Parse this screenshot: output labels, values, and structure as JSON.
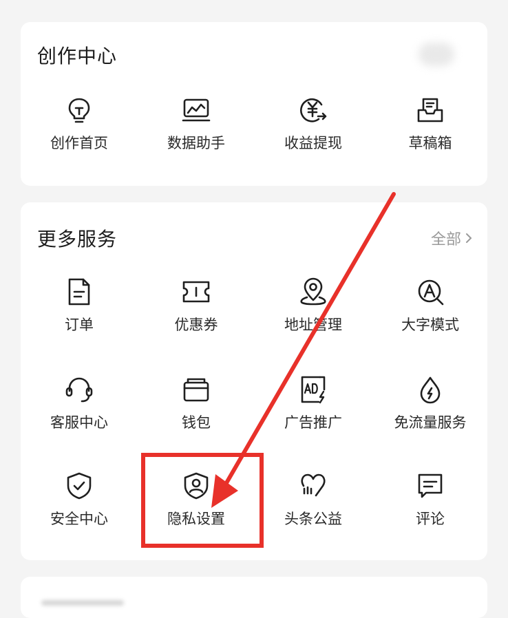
{
  "creation_center": {
    "title": "创作中心",
    "items": [
      {
        "label": "创作首页",
        "icon": "lightbulb-icon"
      },
      {
        "label": "数据助手",
        "icon": "chart-monitor-icon"
      },
      {
        "label": "收益提现",
        "icon": "yuan-withdraw-icon"
      },
      {
        "label": "草稿箱",
        "icon": "draft-box-icon"
      }
    ]
  },
  "more_services": {
    "title": "更多服务",
    "all_label": "全部",
    "items": [
      {
        "label": "订单",
        "icon": "document-icon"
      },
      {
        "label": "优惠券",
        "icon": "ticket-icon"
      },
      {
        "label": "地址管理",
        "icon": "location-pin-icon"
      },
      {
        "label": "大字模式",
        "icon": "large-font-icon"
      },
      {
        "label": "客服中心",
        "icon": "headset-icon"
      },
      {
        "label": "钱包",
        "icon": "wallet-icon"
      },
      {
        "label": "广告推广",
        "icon": "ad-icon"
      },
      {
        "label": "免流量服务",
        "icon": "water-drop-icon"
      },
      {
        "label": "安全中心",
        "icon": "shield-check-icon"
      },
      {
        "label": "隐私设置",
        "icon": "shield-user-icon"
      },
      {
        "label": "头条公益",
        "icon": "charity-heart-icon"
      },
      {
        "label": "评论",
        "icon": "comment-icon"
      }
    ]
  },
  "annotation": {
    "color": "#e8312a"
  }
}
